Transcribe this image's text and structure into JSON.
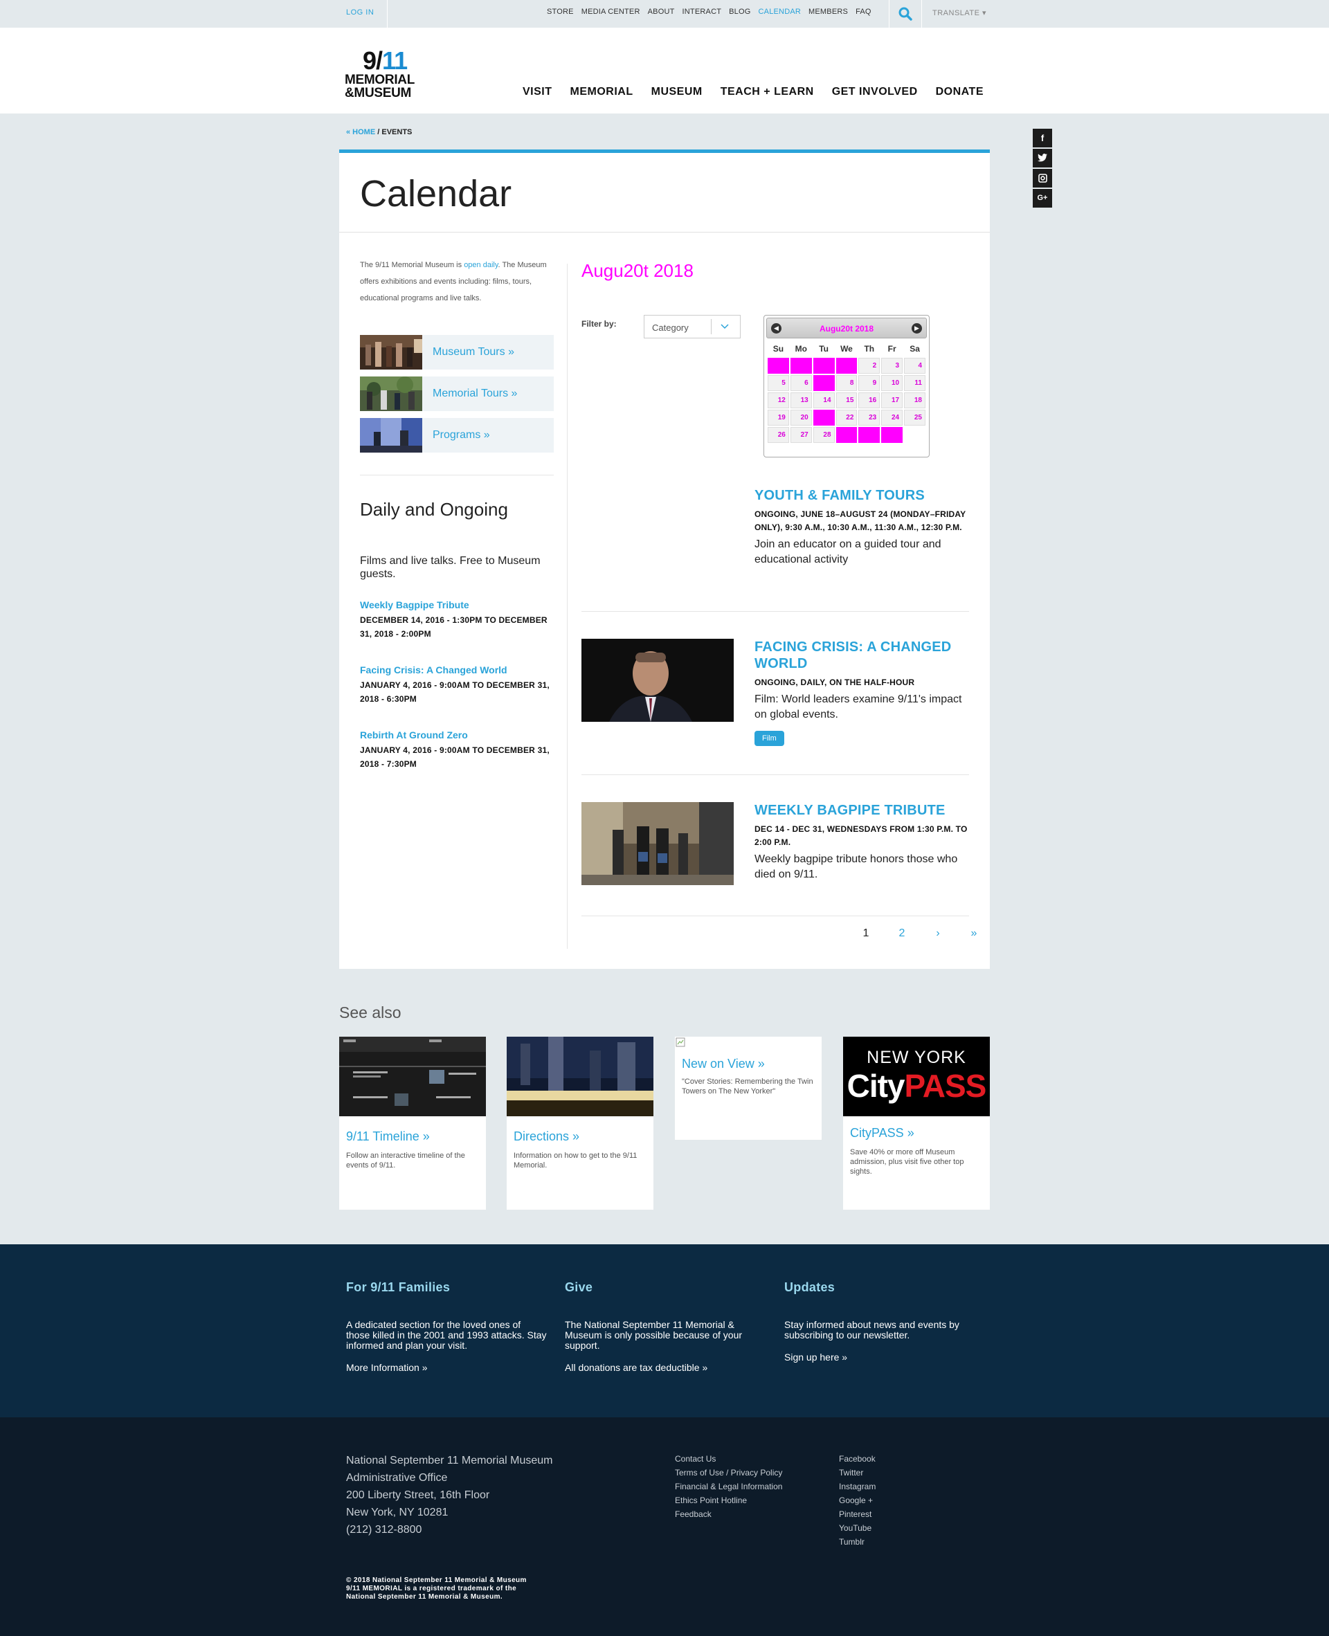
{
  "topbar": {
    "login": "LOG IN",
    "links": [
      "STORE",
      "MEDIA CENTER",
      "ABOUT",
      "INTERACT",
      "BLOG",
      "CALENDAR",
      "MEMBERS",
      "FAQ"
    ],
    "active_link": "CALENDAR",
    "search_icon": "search-icon",
    "translate": "TRANSLATE ▾"
  },
  "logo": {
    "line1a": "9/",
    "line1b": "11",
    "line2": "MEMORIAL",
    "line3": "&MUSEUM"
  },
  "nav": [
    "VISIT",
    "MEMORIAL",
    "MUSEUM",
    "TEACH + LEARN",
    "GET INVOLVED",
    "DONATE"
  ],
  "social": [
    "f",
    "t",
    "ig",
    "G+"
  ],
  "breadcrumb": {
    "home": "« HOME",
    "sep": " / ",
    "current": "EVENTS"
  },
  "page_title": "Calendar",
  "intro": {
    "before": "The 9/11 Memorial Museum is ",
    "link": "open daily",
    "after": ". The Museum offers exhibitions and events including: films, tours, educational programs and live talks."
  },
  "promos": [
    {
      "label": "Museum Tours »"
    },
    {
      "label": "Memorial Tours »"
    },
    {
      "label": "Programs »"
    }
  ],
  "daily": {
    "heading": "Daily and Ongoing",
    "text": "Films and live talks. Free to Museum guests.",
    "items": [
      {
        "title": "Weekly Bagpipe Tribute",
        "date": "DECEMBER 14, 2016 - 1:30PM TO DECEMBER 31, 2018 - 2:00PM"
      },
      {
        "title": "Facing Crisis: A Changed World",
        "date": "JANUARY 4, 2016 - 9:00AM TO DECEMBER 31, 2018 - 6:30PM"
      },
      {
        "title": "Rebirth At Ground Zero",
        "date": "JANUARY 4, 2016 - 9:00AM TO DECEMBER 31, 2018 - 7:30PM"
      }
    ]
  },
  "month_header": "Augu20t 2018",
  "filter": {
    "label": "Filter by:",
    "value": "Category"
  },
  "calendar": {
    "title": "Augu20t 2018",
    "weekdays": [
      "Su",
      "Mo",
      "Tu",
      "We",
      "Th",
      "Fr",
      "Sa"
    ],
    "rows": [
      [
        "",
        "",
        "",
        "",
        "2",
        "3",
        "4"
      ],
      [
        "5",
        "6",
        "",
        "8",
        "9",
        "10",
        "11"
      ],
      [
        "12",
        "13",
        "14",
        "15",
        "16",
        "17",
        "18"
      ],
      [
        "19",
        "20",
        "",
        "22",
        "23",
        "24",
        "25"
      ],
      [
        "26",
        "27",
        "28",
        "",
        "",
        "",
        ""
      ]
    ],
    "highlight": [
      [
        0,
        0
      ],
      [
        0,
        1
      ],
      [
        0,
        2
      ],
      [
        0,
        3
      ],
      [
        1,
        2
      ],
      [
        3,
        2
      ],
      [
        4,
        3
      ],
      [
        4,
        4
      ],
      [
        4,
        5
      ]
    ],
    "blank": [
      [
        4,
        6
      ]
    ]
  },
  "events": [
    {
      "title": "YOUTH & FAMILY TOURS",
      "date": "ONGOING, JUNE 18–AUGUST 24 (MONDAY–FRIDAY ONLY), 9:30 A.M., 10:30 A.M., 11:30 A.M., 12:30 P.M.",
      "text": "Join an educator on a guided tour and educational activity",
      "tag": ""
    },
    {
      "title": "FACING CRISIS: A CHANGED WORLD",
      "date": "ONGOING, DAILY, ON THE HALF-HOUR",
      "text": "Film: World leaders examine 9/11's impact on global events.",
      "tag": "Film"
    },
    {
      "title": "WEEKLY BAGPIPE TRIBUTE",
      "date": "DEC 14 - DEC 31, WEDNESDAYS FROM 1:30 P.M. TO 2:00 P.M.",
      "text": "Weekly bagpipe tribute honors those who died on 9/11.",
      "tag": ""
    }
  ],
  "pager": [
    "1",
    "2",
    "›",
    "»"
  ],
  "see_also": {
    "heading": "See also",
    "cards": [
      {
        "title": "9/11 Timeline »",
        "text": "Follow an interactive timeline of the events of 9/11."
      },
      {
        "title": "Directions »",
        "text": "Information on how to get to the 9/11 Memorial."
      },
      {
        "title": "New on View »",
        "text": "\"Cover Stories: Remembering the Twin Towers on The New Yorker\""
      },
      {
        "title": "CityPASS »",
        "text": "Save 40% or more off Museum admission, plus visit five other top sights.",
        "logo_top": "NEW YORK",
        "logo_a": "City",
        "logo_b": "PASS"
      }
    ]
  },
  "footer_cols": [
    {
      "heading": "For 9/11 Families",
      "text": "A dedicated section for the loved ones of those killed in the 2001 and 1993 attacks. Stay informed and plan your visit.",
      "link": "More Information »"
    },
    {
      "heading": "Give",
      "text": "The National September 11 Memorial & Museum is only possible because of your support.",
      "link": "All donations are tax deductible »"
    },
    {
      "heading": "Updates",
      "text": "Stay informed about news and events by subscribing to our newsletter.",
      "link": "Sign up here »"
    }
  ],
  "address": [
    "National September 11 Memorial Museum",
    "Administrative Office",
    "200 Liberty Street, 16th Floor",
    "New York, NY 10281",
    "(212) 312-8800"
  ],
  "footer_links": [
    "Contact Us",
    "Terms of Use / Privacy Policy",
    "Financial & Legal Information",
    "Ethics Point Hotline",
    "Feedback"
  ],
  "footer_social": [
    "Facebook",
    "Twitter",
    "Instagram",
    "Google +",
    "Pinterest",
    "YouTube",
    "Tumblr"
  ],
  "copyright": [
    "© 2018 National September 11 Memorial & Museum",
    "9/11 MEMORIAL is a registered trademark of the",
    "National September 11 Memorial & Museum."
  ],
  "colors": {
    "accent": "#2aa3d9",
    "footer_top": "#0c2a42",
    "footer_bottom": "#0d1b29",
    "calendar_placeholder": "#ff00ff"
  }
}
